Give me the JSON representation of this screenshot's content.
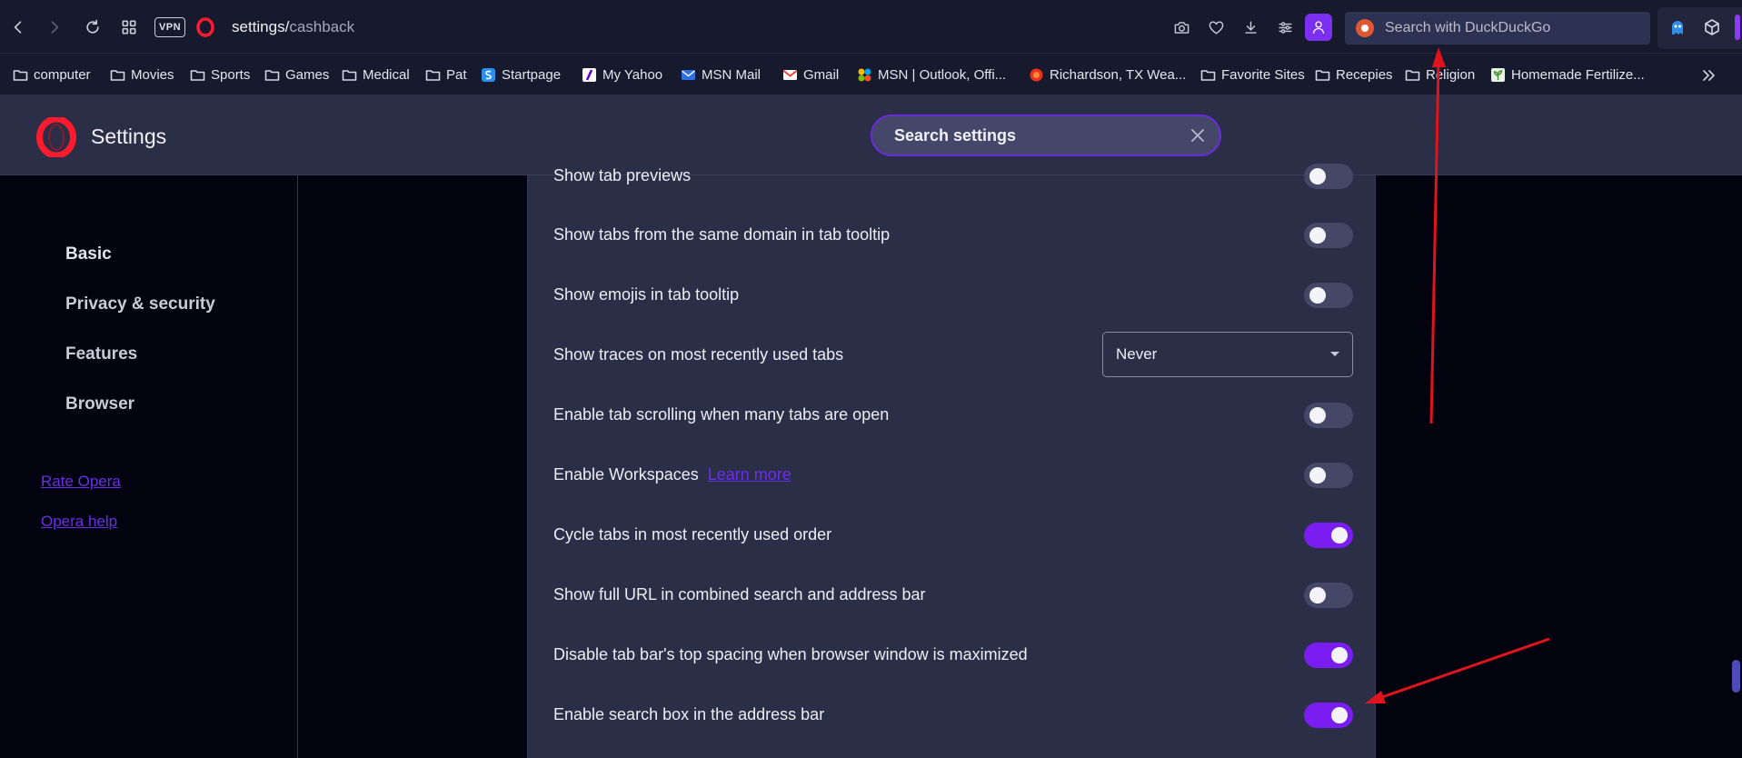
{
  "browser": {
    "url_host": "settings/",
    "url_path": "cashback",
    "vpn_label": "VPN",
    "search_placeholder": "Search with DuckDuckGo"
  },
  "bookmarks": [
    {
      "label": "computer",
      "icon": "folder-icon"
    },
    {
      "label": "Movies",
      "icon": "folder-icon"
    },
    {
      "label": "Sports",
      "icon": "folder-icon"
    },
    {
      "label": "Games",
      "icon": "folder-icon"
    },
    {
      "label": "Medical",
      "icon": "folder-icon"
    },
    {
      "label": "Pat",
      "icon": "folder-icon"
    },
    {
      "label": "Startpage",
      "icon": "startpage-icon"
    },
    {
      "label": "My Yahoo",
      "icon": "yahoo-icon"
    },
    {
      "label": "MSN Mail",
      "icon": "msn-mail-icon"
    },
    {
      "label": "Gmail",
      "icon": "gmail-icon"
    },
    {
      "label": "MSN | Outlook, Offi...",
      "icon": "msn-butterfly-icon"
    },
    {
      "label": "Richardson, TX Wea...",
      "icon": "weather-icon"
    },
    {
      "label": "Favorite Sites",
      "icon": "folder-icon"
    },
    {
      "label": "Recepies",
      "icon": "folder-icon"
    },
    {
      "label": "Religion",
      "icon": "folder-icon"
    },
    {
      "label": "Homemade Fertilize...",
      "icon": "plant-icon"
    }
  ],
  "settings": {
    "title": "Settings",
    "search_label": "Search settings"
  },
  "nav": {
    "items": [
      "Basic",
      "Privacy & security",
      "Features",
      "Browser"
    ],
    "links": [
      "Rate Opera",
      "Opera help"
    ]
  },
  "rows": [
    {
      "label": "Show tab previews",
      "control": "toggle",
      "on": false
    },
    {
      "label": "Show tabs from the same domain in tab tooltip",
      "control": "toggle",
      "on": false
    },
    {
      "label": "Show emojis in tab tooltip",
      "control": "toggle",
      "on": false
    },
    {
      "label": "Show traces on most recently used tabs",
      "control": "select",
      "value": "Never"
    },
    {
      "label": "Enable tab scrolling when many tabs are open",
      "control": "toggle",
      "on": false
    },
    {
      "label": "Enable Workspaces",
      "link": "Learn more",
      "control": "toggle",
      "on": false
    },
    {
      "label": "Cycle tabs in most recently used order",
      "control": "toggle",
      "on": true
    },
    {
      "label": "Show full URL in combined search and address bar",
      "control": "toggle",
      "on": false
    },
    {
      "label": "Disable tab bar's top spacing when browser window is maximized",
      "control": "toggle",
      "on": true
    },
    {
      "label": "Enable search box in the address bar",
      "control": "toggle",
      "on": true
    }
  ],
  "colors": {
    "accent": "#7a1df0",
    "opera_red": "#ff1b2d",
    "annotation_arrow": "#e0141e"
  }
}
